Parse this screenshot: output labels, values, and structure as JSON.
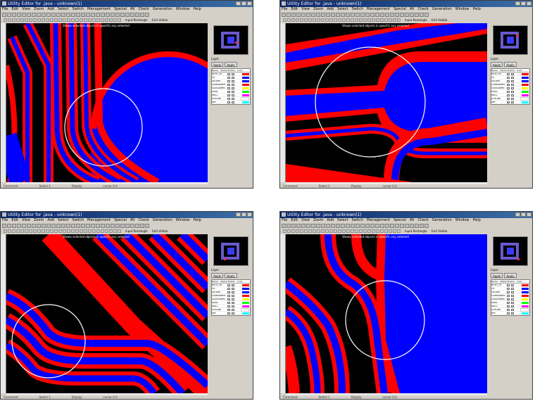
{
  "window": {
    "title": "Utility Editor for .java - unknown(1)",
    "menus": [
      "File",
      "Edit",
      "View",
      "Zoom",
      "Add",
      "Select",
      "Switch",
      "Management",
      "Special",
      "AV",
      "Check",
      "Generation",
      "Window",
      "Help"
    ],
    "buttons": [
      "Input Rectangle",
      "Grid Visible"
    ],
    "canvas_caption": "Shows selected objects in specific any selected",
    "status": [
      "Command",
      "Select 1",
      "Display",
      "cursor 0.0"
    ]
  },
  "panel": {
    "layer_label": "Layer",
    "apply_label": "Apply",
    "column_headers": [
      "Name",
      "Visible Enable",
      "Color"
    ],
    "layers": [
      {
        "name": "BOTH_TH",
        "color": "#ff0000"
      },
      {
        "name": "TH",
        "color": "#0000ff"
      },
      {
        "name": "SOLDER",
        "color": "#0000ff"
      },
      {
        "name": "COMPONENT",
        "color": "#ff0000"
      },
      {
        "name": "SILKSCREEN",
        "color": "#ffff00"
      },
      {
        "name": "MASK",
        "color": "#00ff00"
      },
      {
        "name": "DRILL",
        "color": "#ff00ff"
      },
      {
        "name": "OUTLINE",
        "color": "#ffffff"
      },
      {
        "name": "REF",
        "color": "#00ffff"
      }
    ]
  },
  "colors": {
    "background": "#000000",
    "trace_outer": "#ff0000",
    "trace_inner": "#0000ff",
    "circle": "#ffffff"
  },
  "screenshots": [
    {
      "id": "top-left",
      "description": "traces curving around a filled pad with highlight circle"
    },
    {
      "id": "top-right",
      "description": "horizontal traces with rounded ends and highlight circle"
    },
    {
      "id": "bottom-left",
      "description": "diagonal traces bending to horizontal with highlight circle"
    },
    {
      "id": "bottom-right",
      "description": "traces merging toward a filled area with highlight circle"
    }
  ]
}
